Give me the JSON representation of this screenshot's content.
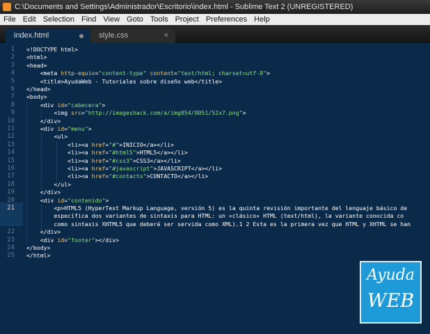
{
  "window": {
    "title": "C:\\Documents and Settings\\Administrador\\Escritorio\\index.html - Sublime Text 2 (UNREGISTERED)"
  },
  "menu": [
    "File",
    "Edit",
    "Selection",
    "Find",
    "View",
    "Goto",
    "Tools",
    "Project",
    "Preferences",
    "Help"
  ],
  "tabs": [
    {
      "label": "index.html",
      "state": "modified-dot"
    },
    {
      "label": "style.css",
      "state": "close"
    }
  ],
  "editor": {
    "current_line": "21",
    "gutter": [
      "1",
      "2",
      "3",
      "4",
      "5",
      "6",
      "7",
      "8",
      "9",
      "10",
      "11",
      "12",
      "13",
      "14",
      "15",
      "16",
      "17",
      "18",
      "19",
      "20",
      "21",
      "",
      "",
      "22",
      "23",
      "24",
      "25"
    ],
    "lines": [
      [
        {
          "c": "t",
          "v": "<!DOCTYPE html>"
        }
      ],
      [
        {
          "c": "t",
          "v": "<html>"
        }
      ],
      [
        {
          "c": "t",
          "v": "<head>"
        }
      ],
      [
        {
          "c": "p",
          "v": "    "
        },
        {
          "c": "t",
          "v": "<meta "
        },
        {
          "c": "a",
          "v": "http-equiv"
        },
        {
          "c": "p",
          "v": "="
        },
        {
          "c": "s",
          "v": "\"content-type\""
        },
        {
          "c": "p",
          "v": " "
        },
        {
          "c": "a",
          "v": "content"
        },
        {
          "c": "p",
          "v": "="
        },
        {
          "c": "s",
          "v": "\"text/html; charset=utf-8\""
        },
        {
          "c": "t",
          "v": ">"
        }
      ],
      [
        {
          "c": "p",
          "v": "    "
        },
        {
          "c": "t",
          "v": "<title>"
        },
        {
          "c": "p",
          "v": "AyudaWeb - Tutoriales sobre diseño web"
        },
        {
          "c": "t",
          "v": "</title>"
        }
      ],
      [
        {
          "c": "t",
          "v": "</head>"
        }
      ],
      [
        {
          "c": "t",
          "v": "<body>"
        }
      ],
      [
        {
          "c": "p",
          "v": "    "
        },
        {
          "c": "t",
          "v": "<div "
        },
        {
          "c": "a",
          "v": "id"
        },
        {
          "c": "p",
          "v": "="
        },
        {
          "c": "s",
          "v": "\"cabecera\""
        },
        {
          "c": "t",
          "v": ">"
        }
      ],
      [
        {
          "c": "p",
          "v": "        "
        },
        {
          "c": "t",
          "v": "<img "
        },
        {
          "c": "a",
          "v": "src"
        },
        {
          "c": "p",
          "v": "="
        },
        {
          "c": "s",
          "v": "\"http://imageshack.com/a/img854/8051/52x7.png\""
        },
        {
          "c": "t",
          "v": ">"
        }
      ],
      [
        {
          "c": "p",
          "v": "    "
        },
        {
          "c": "t",
          "v": "</div>"
        }
      ],
      [
        {
          "c": "p",
          "v": "    "
        },
        {
          "c": "t",
          "v": "<div "
        },
        {
          "c": "a",
          "v": "id"
        },
        {
          "c": "p",
          "v": "="
        },
        {
          "c": "s",
          "v": "\"menu\""
        },
        {
          "c": "t",
          "v": ">"
        }
      ],
      [
        {
          "c": "p",
          "v": "        "
        },
        {
          "c": "t",
          "v": "<ul>"
        }
      ],
      [
        {
          "c": "p",
          "v": "            "
        },
        {
          "c": "t",
          "v": "<li><a "
        },
        {
          "c": "a",
          "v": "href"
        },
        {
          "c": "p",
          "v": "="
        },
        {
          "c": "s",
          "v": "\"#\""
        },
        {
          "c": "t",
          "v": ">"
        },
        {
          "c": "p",
          "v": "INICIO"
        },
        {
          "c": "t",
          "v": "</a></li>"
        }
      ],
      [
        {
          "c": "p",
          "v": "            "
        },
        {
          "c": "t",
          "v": "<li><a "
        },
        {
          "c": "a",
          "v": "href"
        },
        {
          "c": "p",
          "v": "="
        },
        {
          "c": "s",
          "v": "\"#html5\""
        },
        {
          "c": "t",
          "v": ">"
        },
        {
          "c": "p",
          "v": "HTML5"
        },
        {
          "c": "t",
          "v": "</a></li>"
        }
      ],
      [
        {
          "c": "p",
          "v": "            "
        },
        {
          "c": "t",
          "v": "<li><a "
        },
        {
          "c": "a",
          "v": "href"
        },
        {
          "c": "p",
          "v": "="
        },
        {
          "c": "s",
          "v": "\"#css3\""
        },
        {
          "c": "t",
          "v": ">"
        },
        {
          "c": "p",
          "v": "CSS3"
        },
        {
          "c": "t",
          "v": "</a></li>"
        }
      ],
      [
        {
          "c": "p",
          "v": "            "
        },
        {
          "c": "t",
          "v": "<li><a "
        },
        {
          "c": "a",
          "v": "href"
        },
        {
          "c": "p",
          "v": "="
        },
        {
          "c": "s",
          "v": "\"#javascript\""
        },
        {
          "c": "t",
          "v": ">"
        },
        {
          "c": "p",
          "v": "JAVASCRIPT"
        },
        {
          "c": "t",
          "v": "</a></li>"
        }
      ],
      [
        {
          "c": "p",
          "v": "            "
        },
        {
          "c": "t",
          "v": "<li><a "
        },
        {
          "c": "a",
          "v": "href"
        },
        {
          "c": "p",
          "v": "="
        },
        {
          "c": "s",
          "v": "\"#contacto\""
        },
        {
          "c": "t",
          "v": ">"
        },
        {
          "c": "p",
          "v": "CONTACTO"
        },
        {
          "c": "t",
          "v": "</a></li>"
        }
      ],
      [
        {
          "c": "p",
          "v": "        "
        },
        {
          "c": "t",
          "v": "</ul>"
        }
      ],
      [
        {
          "c": "p",
          "v": "    "
        },
        {
          "c": "t",
          "v": "</div>"
        }
      ],
      [
        {
          "c": "p",
          "v": "    "
        },
        {
          "c": "t",
          "v": "<div "
        },
        {
          "c": "a",
          "v": "id"
        },
        {
          "c": "p",
          "v": "="
        },
        {
          "c": "s",
          "v": "\"contenido\""
        },
        {
          "c": "t",
          "v": ">"
        }
      ],
      [
        {
          "c": "p",
          "v": "        "
        },
        {
          "c": "t",
          "v": "<p>"
        },
        {
          "c": "p",
          "v": "HTML5 (HyperText Markup Language, versión 5) es la quinta revisión importante del lenguaje básico de"
        }
      ],
      [
        {
          "c": "p",
          "v": "        específica dos variantes de sintaxis para HTML: un «clásico» HTML (text/html), la variante conocida co"
        }
      ],
      [
        {
          "c": "p",
          "v": "        como sintaxis XHTML5 que deberá ser servida como XML).1 2 Esta es la primera vez que HTML y XHTML se han"
        }
      ],
      [
        {
          "c": "p",
          "v": "    "
        },
        {
          "c": "t",
          "v": "</div>"
        }
      ],
      [
        {
          "c": "p",
          "v": "    "
        },
        {
          "c": "t",
          "v": "<div "
        },
        {
          "c": "a",
          "v": "id"
        },
        {
          "c": "p",
          "v": "="
        },
        {
          "c": "s",
          "v": "\"footer\""
        },
        {
          "c": "t",
          "v": "></div>"
        }
      ],
      [
        {
          "c": "t",
          "v": "</body>"
        }
      ],
      [
        {
          "c": "t",
          "v": "</html>"
        }
      ]
    ]
  },
  "logo": {
    "line1": "Ayuda",
    "line2": "WEB"
  }
}
